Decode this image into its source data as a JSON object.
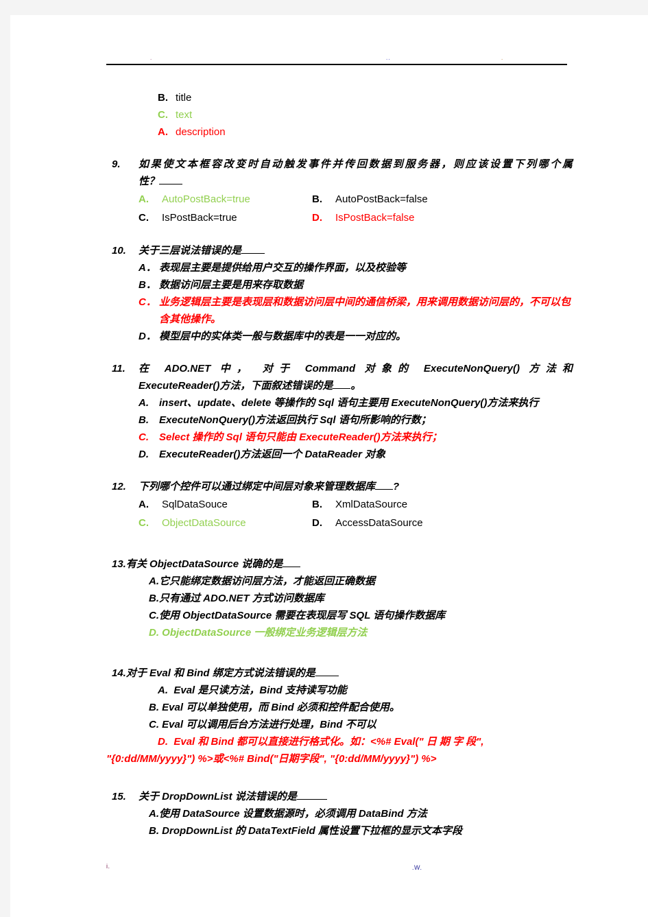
{
  "page": {
    "header": {
      "marks": [
        ".",
        "..",
        "."
      ],
      "rule": true
    },
    "footer": {
      "left_mark": "i.",
      "right_mark": ".W."
    }
  },
  "colors": {
    "answer_green": "#92D050",
    "answer_red": "#FF0000",
    "default_black": "#000000"
  },
  "orphan_options": [
    {
      "label": "B.",
      "text": "title",
      "color": "black"
    },
    {
      "label": "C.",
      "text": "text",
      "color": "green"
    },
    {
      "label": "A.",
      "text": "description",
      "color": "red"
    }
  ],
  "questions": [
    {
      "number": "9.",
      "stem_line1": "如果使文本框容改变时自动触发事件并传回数据到服务器，则应该设置下列哪个属",
      "stem_line2": "性？",
      "layout": "two-column",
      "options": [
        {
          "label": "A.",
          "text": "AutoPostBack=true",
          "color": "green"
        },
        {
          "label": "B.",
          "text": "AutoPostBack=false",
          "color": "black"
        },
        {
          "label": "C.",
          "text": "IsPostBack=true",
          "color": "black"
        },
        {
          "label": "D.",
          "text": "IsPostBack=false",
          "color": "red"
        }
      ]
    },
    {
      "number": "10.",
      "stem_line1": "关于三层说法错误的是",
      "layout": "single-column",
      "options": [
        {
          "label": "A．",
          "text": "表现层主要是提供给用户交互的操作界面，以及校验等",
          "color": "black"
        },
        {
          "label": "B．",
          "text": "数据访问层主要是用来存取数据",
          "color": "black"
        },
        {
          "label": "C．",
          "text": "业务逻辑层主要是表现层和数据访问层中间的通信桥梁，用来调用数据访问层的，不可以包含其他操作。",
          "color": "red"
        },
        {
          "label": "D．",
          "text": "模型层中的实体类一般与数据库中的表是一一对应的。",
          "color": "black"
        }
      ]
    },
    {
      "number": "11.",
      "stem_line1": "在 ADO.NET 中， 对于 Command 对象的 ExecuteNonQuery() 方法和",
      "stem_line2": "ExecuteReader()方法，下面叙述错误的是",
      "stem_line2_tail": "。",
      "layout": "single-column",
      "options": [
        {
          "label": "A.",
          "text": "insert、update、delete 等操作的 Sql 语句主要用 ExecuteNonQuery()方法来执行",
          "color": "black"
        },
        {
          "label": "B.",
          "text": "ExecuteNonQuery()方法返回执行 Sql 语句所影响的行数；",
          "color": "black"
        },
        {
          "label": "C.",
          "text": "Select 操作的 Sql 语句只能由 ExecuteReader()方法来执行；",
          "color": "red"
        },
        {
          "label": "D.",
          "text": "ExecuteReader()方法返回一个 DataReader 对象",
          "color": "black"
        }
      ]
    },
    {
      "number": "12.",
      "stem_line1": "下列哪个控件可以通过绑定中间层对象来管理数据库",
      "stem_tail": "?",
      "layout": "two-column",
      "options": [
        {
          "label": "A.",
          "text": "SqlDataSouce",
          "color": "black"
        },
        {
          "label": "B.",
          "text": "XmlDataSource",
          "color": "black"
        },
        {
          "label": "C.",
          "text": "ObjectDataSource",
          "color": "green"
        },
        {
          "label": "D.",
          "text": "AccessDataSource",
          "color": "black"
        }
      ]
    },
    {
      "number": "13.",
      "stem_line1": "有关 ObjectDataSource 说确的是",
      "layout": "tight",
      "options": [
        {
          "label": "A.",
          "text": "它只能绑定数据访问层方法，才能返回正确数据",
          "color": "black"
        },
        {
          "label": "B.",
          "text": "只有通过 ADO.NET 方式访问数据库",
          "color": "black"
        },
        {
          "label": "C.",
          "text": "使用 ObjectDataSource 需要在表现层写 SQL 语句操作数据库",
          "color": "black"
        },
        {
          "label": "D. ",
          "text": "ObjectDataSource 一般绑定业务逻辑层方法",
          "color": "green"
        }
      ]
    },
    {
      "number": "14.",
      "stem_line1": "对于 Eval 和 Bind 绑定方式说法错误的是",
      "layout": "tight",
      "options": [
        {
          "label": "A.",
          "text": "Eval 是只读方法，Bind 支持读写功能",
          "color": "black"
        },
        {
          "label": "B.",
          "text": "Eval 可以单独使用，而 Bind 必须和控件配合使用。",
          "color": "black"
        },
        {
          "label": "C.",
          "text": "Eval 可以调用后台方法进行处理，Bind 不可以",
          "color": "black"
        },
        {
          "label": "D.",
          "text": "Eval 和 Bind 都可以直接进行格式化。如：<%# Eval(\" 日 期 字 段\",",
          "color": "red"
        }
      ],
      "option_d_continuation": "\"{0:dd/MM/yyyy}\") %>或<%# Bind(\"日期字段\", \"{0:dd/MM/yyyy}\") %>"
    },
    {
      "number": "15.",
      "stem_line1": "关于 DropDownList 说法错误的是",
      "layout": "tight",
      "options": [
        {
          "label": "A.",
          "text": "使用 DataSource 设置数据源时，必须调用 DataBind 方法",
          "color": "black"
        },
        {
          "label": "B. ",
          "text": "DropDownList 的 DataTextField 属性设置下拉框的显示文本字段",
          "color": "black"
        }
      ]
    }
  ]
}
